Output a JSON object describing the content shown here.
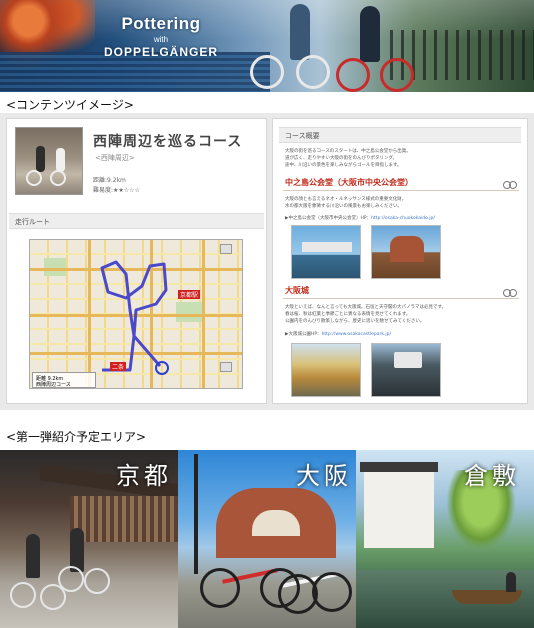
{
  "banner": {
    "title": "Pottering",
    "with": "with",
    "subtitle": "DOPPELGÄNGER"
  },
  "sections": {
    "content_image": "<コンテンツイメージ>",
    "areas": "<第一弾紹介予定エリア>"
  },
  "course": {
    "title": "西陣周辺を巡るコース",
    "subtitle": "<西陣周辺>",
    "distance": "距離:9.2km",
    "difficulty": "難易度:★★☆☆☆",
    "route_label": "走行ルート"
  },
  "map": {
    "pins": [
      "京都駅",
      "二条"
    ],
    "legend_line1": "距離 9.2km",
    "legend_line2": "西陣周辺コース"
  },
  "overview": {
    "label": "コース概要",
    "intro_lines": [
      "大阪の街を巡るコースのスタートは、中之島公会堂から出発。",
      "道が広く、走りやすい大阪の街をのんびりポタリング。",
      "途中、川沿いの景色を楽しみながらゴールを目指します。"
    ],
    "spots": [
      {
        "name": "中之島公会堂（大阪市中央公会堂）",
        "text_lines": [
          "大阪の顔とも言えるネオ・ルネッサンス様式の重要文化財。",
          "水の都大阪を象徴する川沿いの風景もお楽しみください。"
        ],
        "link_prefix": "▶中之島公会堂（大阪市中央公会堂）HP：",
        "link_url": "http://osaka-chuokokaido.jp/"
      },
      {
        "name": "大阪城",
        "text_lines": [
          "大阪といえば、なんと言っても大阪城。石垣と天守閣の大パノラマは必見です。",
          "春は桜、秋は紅葉と季節ごとに異なる表情を見せてくれます。",
          "公園内をのんびり散策しながら、歴史に思いを馳せてみてください。"
        ],
        "link_prefix": "▶大阪城公園HP：",
        "link_url": "http://www.osakacastlepark.jp/"
      }
    ]
  },
  "areas": [
    {
      "name": "京都"
    },
    {
      "name": "大阪"
    },
    {
      "name": "倉敷"
    }
  ]
}
